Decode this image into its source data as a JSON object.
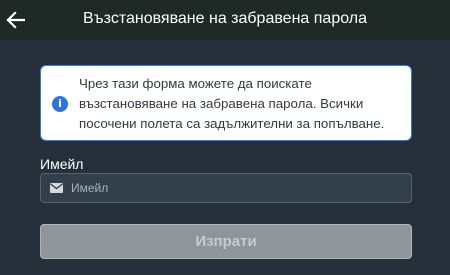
{
  "header": {
    "title": "Възстановяване на забравена парола",
    "back_icon": "arrow-left-icon"
  },
  "info": {
    "icon": "info-icon",
    "icon_glyph": "i",
    "text": "Чрез тази форма можете да поискате възстановяване на забравена парола. Всички посочени полета са задължителни за попълване."
  },
  "email": {
    "label": "Имейл",
    "icon": "envelope-icon",
    "placeholder": "Имейл",
    "value": ""
  },
  "submit": {
    "label": "Изпрати",
    "state": "disabled"
  },
  "colors": {
    "header_bg": "#1f2a27",
    "page_bg": "#26303a",
    "accent": "#2f74d8",
    "button_disabled": "#8f959b"
  }
}
